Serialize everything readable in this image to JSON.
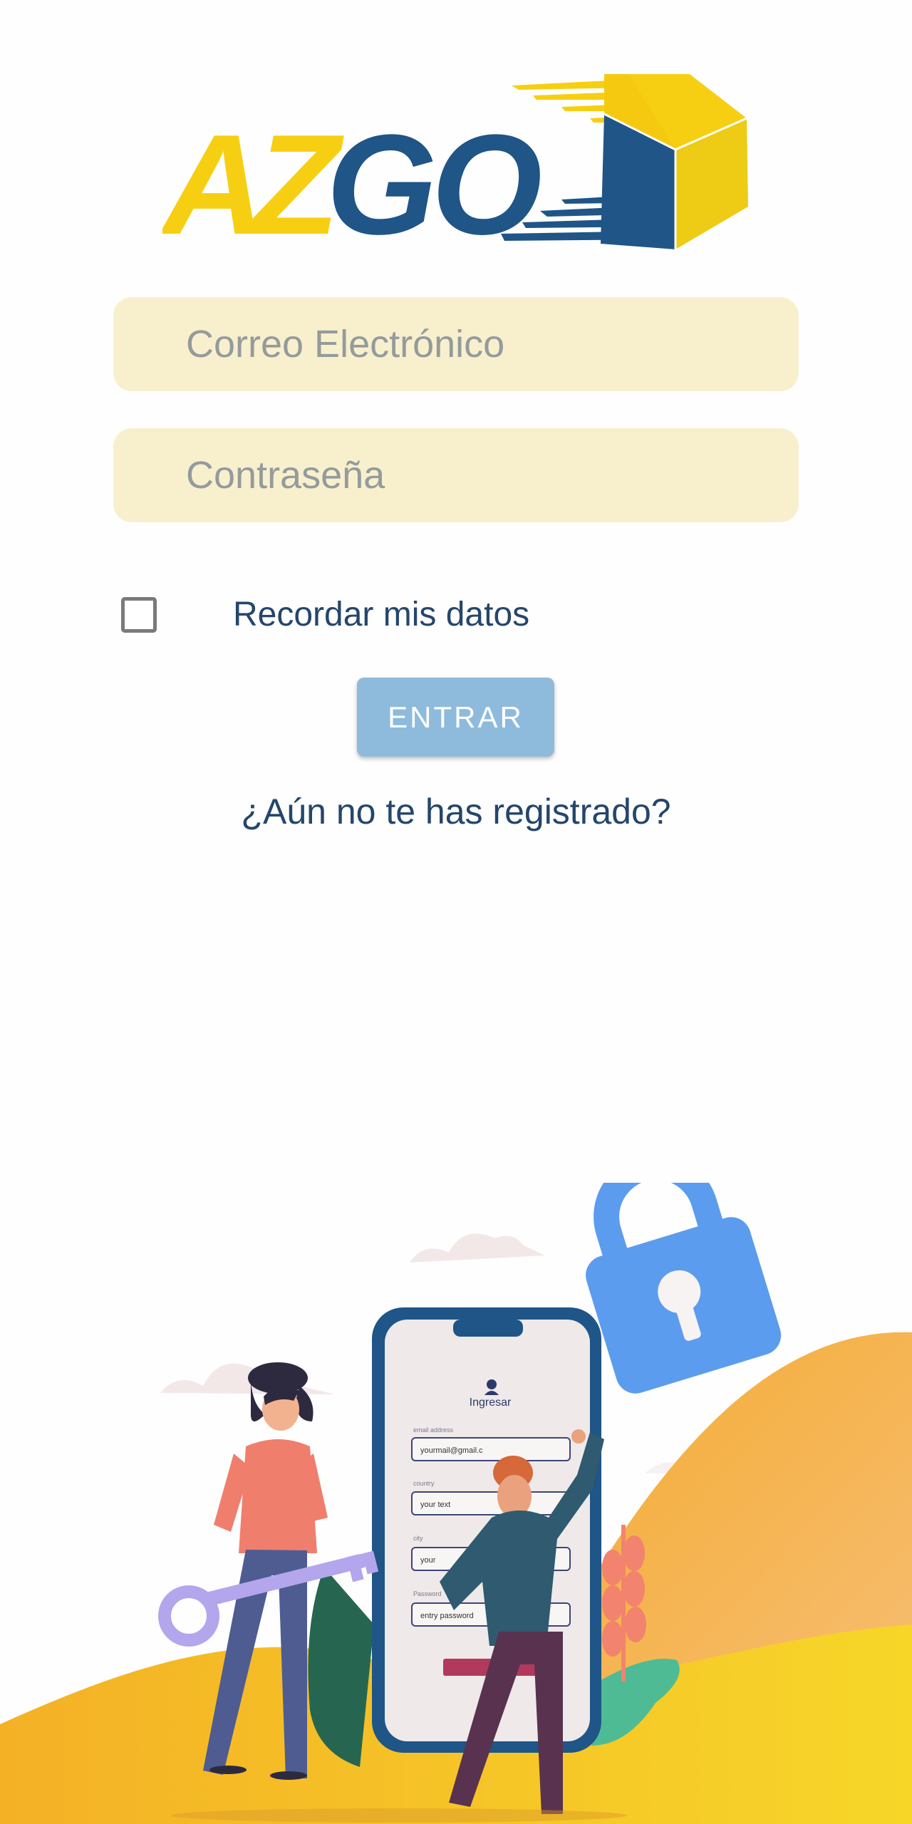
{
  "brand": {
    "logo_text_a": "AZ",
    "logo_text_b": "GO",
    "colors": {
      "yellow": "#f7cf12",
      "blue": "#1f5587"
    }
  },
  "login_form": {
    "email_placeholder": "Correo Electrónico",
    "password_placeholder": "Contraseña",
    "remember_label": "Recordar mis datos",
    "remember_checked": false,
    "submit_label": "ENTRAR",
    "register_link": "¿Aún no te has registrado?"
  },
  "illustration": {
    "phone_screen_title": "Ingresar",
    "field_labels": [
      "email address",
      "country",
      "city",
      "Password"
    ],
    "field_values": [
      "yourmail@gmail.c",
      "your text",
      "your",
      "entry password"
    ]
  },
  "colors": {
    "input_bg": "#f8efcd",
    "button_bg": "#8ebbdc",
    "text_dark_blue": "#25466c"
  }
}
